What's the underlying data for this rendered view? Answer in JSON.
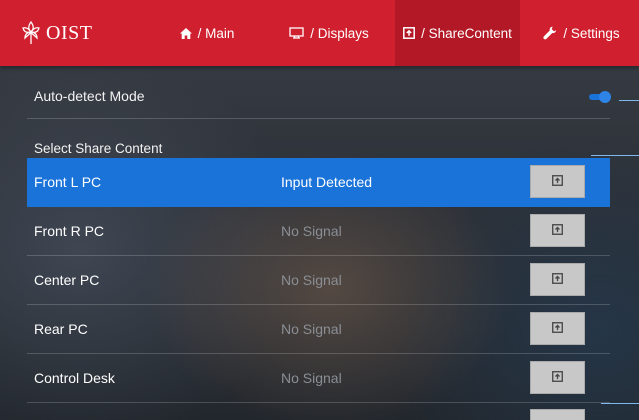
{
  "brand": {
    "logo_text": "OIST"
  },
  "nav": {
    "tabs": [
      {
        "label": "/ Main",
        "icon": "home-icon"
      },
      {
        "label": "/ Displays",
        "icon": "display-icon"
      },
      {
        "label": "/ ShareContent",
        "icon": "share-content-icon",
        "active": true
      },
      {
        "label": "/ Settings",
        "icon": "wrench-icon"
      }
    ]
  },
  "auto_detect": {
    "label": "Auto-detect Mode",
    "enabled": true
  },
  "share_section": {
    "title": "Select Share Content",
    "items": [
      {
        "name": "Front L PC",
        "status": "Input Detected",
        "selected": true
      },
      {
        "name": "Front R PC",
        "status": "No Signal",
        "selected": false
      },
      {
        "name": "Center PC",
        "status": "No Signal",
        "selected": false
      },
      {
        "name": "Rear PC",
        "status": "No Signal",
        "selected": false
      },
      {
        "name": "Control Desk",
        "status": "No Signal",
        "selected": false
      }
    ]
  },
  "colors": {
    "brand_red": "#d01f2e",
    "active_tab": "#b21826",
    "selected_blue": "#1a73d9",
    "muted_status": "#8a8e95",
    "button_gray": "#c8c8c8"
  }
}
